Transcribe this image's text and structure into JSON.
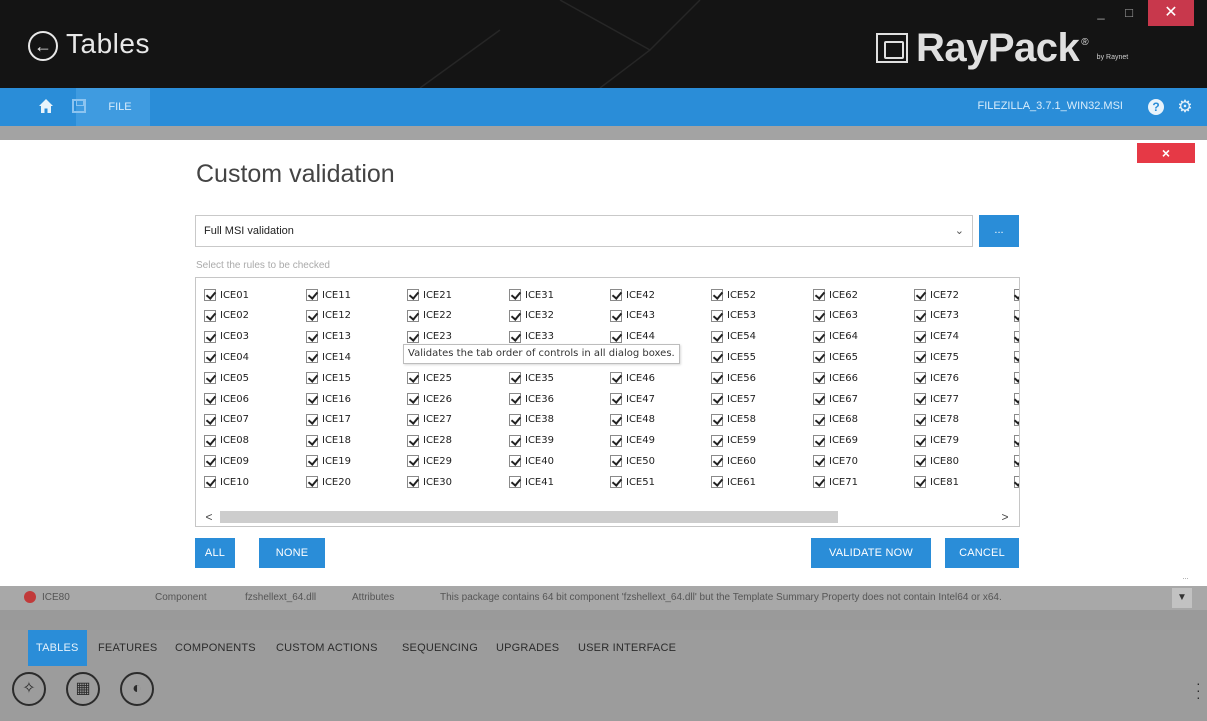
{
  "window": {
    "title": "Tables",
    "back_icon": "back-arrow-icon",
    "brand": {
      "name": "RayPack",
      "trademark": "®",
      "by": "by Raynet"
    },
    "controls": {
      "minimize": "_",
      "maximize": "□",
      "close": "✕"
    }
  },
  "toolbar": {
    "file_label": "FILE",
    "package_name": "FILEZILLA_3.7.1_WIN32.MSI",
    "help_label": "?",
    "icons": [
      "home-icon",
      "save-icon",
      "help-icon",
      "gear-icon"
    ]
  },
  "dialog": {
    "close_label": "×",
    "title": "Custom validation",
    "profile_value": "Full MSI validation",
    "browse_label": "...",
    "rules_hint": "Select the rules to be checked",
    "tooltip": "Validates the tab order of controls in all dialog boxes.",
    "rule_columns": [
      [
        "ICE01",
        "ICE02",
        "ICE03",
        "ICE04",
        "ICE05",
        "ICE06",
        "ICE07",
        "ICE08",
        "ICE09",
        "ICE10"
      ],
      [
        "ICE11",
        "ICE12",
        "ICE13",
        "ICE14",
        "ICE15",
        "ICE16",
        "ICE17",
        "ICE18",
        "ICE19",
        "ICE20"
      ],
      [
        "ICE21",
        "ICE22",
        "ICE23",
        "",
        "ICE25",
        "ICE26",
        "ICE27",
        "ICE28",
        "ICE29",
        "ICE30"
      ],
      [
        "ICE31",
        "ICE32",
        "ICE33",
        "",
        "ICE35",
        "ICE36",
        "ICE38",
        "ICE39",
        "ICE40",
        "ICE41"
      ],
      [
        "ICE42",
        "ICE43",
        "ICE44",
        "",
        "ICE46",
        "ICE47",
        "ICE48",
        "ICE49",
        "ICE50",
        "ICE51"
      ],
      [
        "ICE52",
        "ICE53",
        "ICE54",
        "ICE55",
        "ICE56",
        "ICE57",
        "ICE58",
        "ICE59",
        "ICE60",
        "ICE61"
      ],
      [
        "ICE62",
        "ICE63",
        "ICE64",
        "ICE65",
        "ICE66",
        "ICE67",
        "ICE68",
        "ICE69",
        "ICE70",
        "ICE71"
      ],
      [
        "ICE72",
        "ICE73",
        "ICE74",
        "ICE75",
        "ICE76",
        "ICE77",
        "ICE78",
        "ICE79",
        "ICE80",
        "ICE81"
      ],
      [
        "",
        "",
        "",
        "",
        "",
        "",
        "",
        "",
        "",
        ""
      ]
    ],
    "rules_checked": true,
    "hscroll": {
      "left": "<",
      "right": ">"
    },
    "buttons": {
      "all": "ALL",
      "none": "NONE",
      "validate": "VALIDATE NOW",
      "cancel": "CANCEL"
    }
  },
  "background_row": {
    "name": "ICE80",
    "table": "Component",
    "component": "fzshellext_64.dll",
    "column": "Attributes",
    "message": "This package contains 64 bit component 'fzshellext_64.dll' but the Template Summary Property does not contain Intel64 or x64."
  },
  "bottom_tabs": [
    "TABLES",
    "FEATURES",
    "COMPONENTS",
    "CUSTOM ACTIONS",
    "SEQUENCING",
    "UPGRADES",
    "USER INTERFACE"
  ],
  "bottom_icons": [
    "magic-wand-icon",
    "table-icon",
    "speaker-icon"
  ],
  "colors": {
    "accent": "#2a8dd8",
    "titlebar": "#141414",
    "close_red": "#e63946"
  }
}
